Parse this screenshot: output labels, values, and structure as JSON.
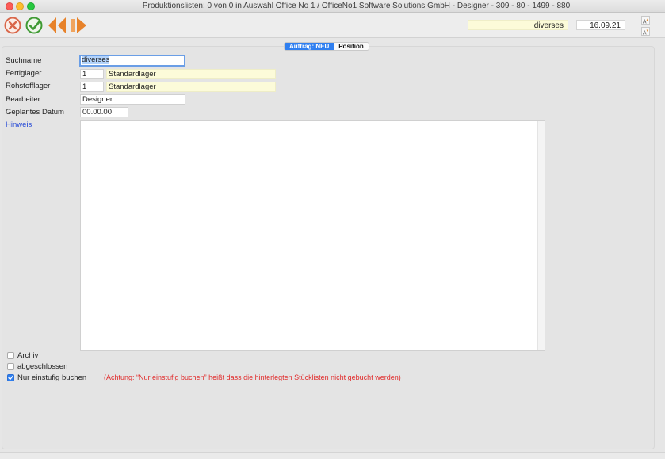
{
  "window": {
    "title": "Produktionslisten: 0 von 0 in Auswahl Office No 1 /  OfficeNo1 Software Solutions GmbH - Designer - 309 - 80 - 1499 - 880"
  },
  "toolbar": {
    "buttons": [
      {
        "name": "cancel",
        "icon": "cancel-x-icon",
        "color": "#d9674a"
      },
      {
        "name": "confirm",
        "icon": "checkmark-icon",
        "color": "#3f9a33"
      },
      {
        "name": "previous",
        "icon": "double-arrow-left-icon",
        "color": "#e7822a"
      },
      {
        "name": "next",
        "icon": "arrow-right-icon",
        "color": "#e7822a"
      }
    ],
    "header_name": "diverses",
    "header_date": "16.09.21",
    "font_larger_label": "A",
    "font_smaller_label": "A"
  },
  "tabs": [
    {
      "label": "Auftrag: NEU",
      "active": true
    },
    {
      "label": "Position",
      "active": false
    }
  ],
  "form": {
    "suchname": {
      "label": "Suchname",
      "value": "diverses"
    },
    "fertiglager": {
      "label": "Fertiglager",
      "number": "1",
      "name": "Standardlager"
    },
    "rohstofflager": {
      "label": "Rohstofflager",
      "number": "1",
      "name": "Standardlager"
    },
    "bearbeiter": {
      "label": "Bearbeiter",
      "value": "Designer"
    },
    "geplantes_datum": {
      "label": "Geplantes Datum",
      "value": "00.00.00"
    },
    "hinweis": {
      "label": "Hinweis",
      "value": ""
    }
  },
  "checkboxes": [
    {
      "label": "Archiv",
      "checked": false
    },
    {
      "label": "abgeschlossen",
      "checked": false
    },
    {
      "label": "Nur einstufig buchen",
      "checked": true
    }
  ],
  "warning": "(Achtung: “Nur einstufig buchen” heißt dass die hinterlegten Stücklisten nicht gebucht werden)",
  "colors": {
    "accent": "#2f7ff0",
    "warning": "#e12b2b",
    "link": "#2448d6",
    "lookup_field": "#fcfbd9"
  }
}
